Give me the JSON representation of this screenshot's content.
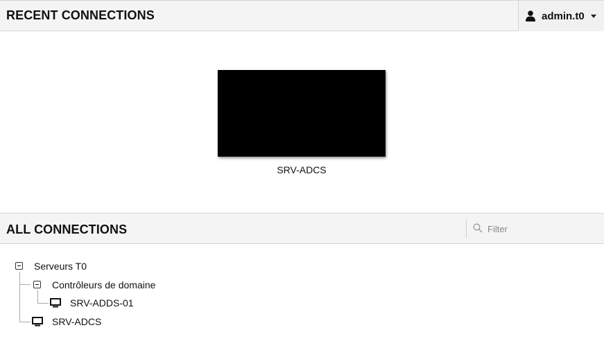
{
  "recent": {
    "title": "RECENT CONNECTIONS",
    "tiles": [
      {
        "name": "SRV-ADCS"
      }
    ]
  },
  "user": {
    "name": "admin.t0",
    "icon": "user-icon"
  },
  "all": {
    "title": "ALL CONNECTIONS",
    "filter_placeholder": "Filter",
    "tree": {
      "group": "Serveurs T0",
      "subgroup": "Contrôleurs de domaine",
      "subgroup_item": "SRV-ADDS-01",
      "item": "SRV-ADCS"
    }
  },
  "colors": {
    "header_bg": "#f4f4f4",
    "border": "#d6d6d6",
    "thumbnail": "#000000"
  }
}
